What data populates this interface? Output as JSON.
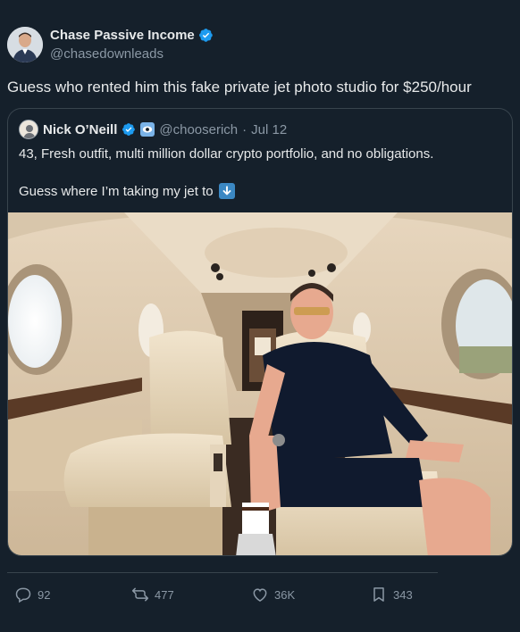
{
  "author": {
    "name": "Chase Passive Income",
    "handle": "@chasedownleads",
    "verified": true
  },
  "post": {
    "text": "Guess who rented him this fake private jet photo studio for $250/hour"
  },
  "quoted": {
    "name": "Nick O’Neill",
    "handle": "@chooserich",
    "separator": "·",
    "date": "Jul 12",
    "line1": "43, Fresh outfit, multi million dollar crypto portfolio, and no obligations.",
    "line2": "Guess where I’m taking my jet to",
    "photo_icon": "private-jet-cabin-photo"
  },
  "actions": {
    "replies": "92",
    "reposts": "477",
    "likes": "36K",
    "bookmarks": "343"
  },
  "colors": {
    "background": "#15202b",
    "text": "#e7e9ea",
    "muted": "#8b98a5",
    "verified": "#1d9bf0",
    "border": "#38444d"
  }
}
